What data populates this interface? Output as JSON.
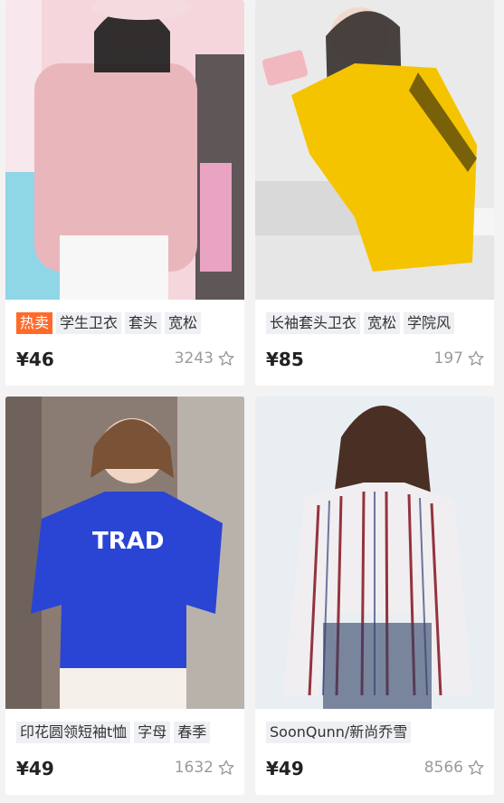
{
  "products": [
    {
      "tags": [
        "热卖",
        "学生卫衣",
        "套头",
        "宽松"
      ],
      "price": "¥46",
      "likes": "3243"
    },
    {
      "tags": [
        "长袖套头卫衣",
        "宽松",
        "学院风"
      ],
      "price": "¥85",
      "likes": "197"
    },
    {
      "tags": [
        "印花圆领短袖t恤",
        "字母",
        "春季"
      ],
      "price": "¥49",
      "likes": "1632"
    },
    {
      "tags": [
        "SoonQunn/新尚乔雪"
      ],
      "price": "¥49",
      "likes": "8566"
    }
  ],
  "images": {
    "p1_colors": {
      "bg": "#f3c9d0",
      "top": "#e7b2b6"
    },
    "p2_colors": {
      "bg": "#e8e8e8",
      "top": "#f6c200"
    },
    "p3_colors": {
      "bg": "#8a7b72",
      "top": "#2a45d4"
    },
    "p4_colors": {
      "bg": "#e9eef3",
      "top": "#d8d8e2"
    },
    "p3_shirt_text": "TRAD"
  },
  "icons": {
    "favorite": "star-outline-icon"
  }
}
